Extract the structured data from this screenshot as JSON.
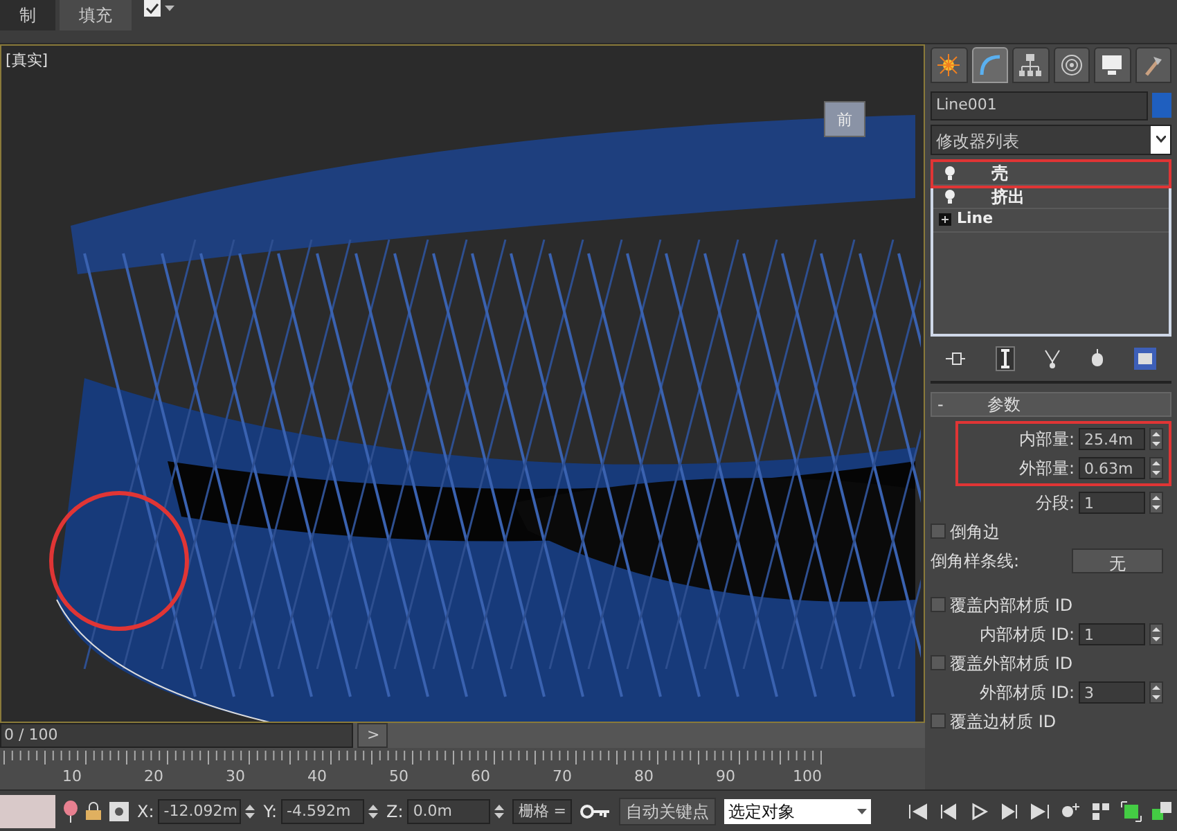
{
  "ribbon_tabs": [
    {
      "label": "制",
      "selected": true
    },
    {
      "label": "填充",
      "selected": false
    }
  ],
  "viewport": {
    "label": "[真实]",
    "viewcube_label": "前",
    "circle_marked": true
  },
  "command_tabs": [
    {
      "kind": "create",
      "selected": false
    },
    {
      "kind": "modify",
      "selected": true
    },
    {
      "kind": "hierarchy",
      "selected": false
    },
    {
      "kind": "motion",
      "selected": false
    },
    {
      "kind": "display",
      "selected": false
    },
    {
      "kind": "utilities",
      "selected": false
    }
  ],
  "object": {
    "name": "Line001",
    "color": "#1f5fbf"
  },
  "modifier_list": "修改器列表",
  "stack": [
    {
      "label": "壳",
      "kind": "modifier",
      "outlined": true
    },
    {
      "label": "挤出",
      "kind": "modifier",
      "outlined": false
    },
    {
      "label": "Line",
      "kind": "base",
      "outlined": false
    }
  ],
  "rollout": {
    "toggle": "-",
    "title": "参数",
    "outlined_spinners": [
      {
        "label": "内部量:",
        "value": "25.4m"
      },
      {
        "label": "外部量:",
        "value": "0.63m"
      }
    ],
    "spinners": [
      {
        "label": "分段:",
        "value": "1"
      }
    ],
    "bevel_edges": {
      "label": "倒角边",
      "checked": false
    },
    "bevel_spline": {
      "label": "倒角样条线:",
      "value": "无"
    },
    "overrides": [
      {
        "label": "覆盖内部材质 ID",
        "checked": false,
        "id_label": "内部材质 ID:",
        "id_value": "1"
      },
      {
        "label": "覆盖外部材质 ID",
        "checked": false,
        "id_label": "外部材质 ID:",
        "id_value": "3"
      },
      {
        "label": "覆盖边材质 ID",
        "checked": false
      }
    ]
  },
  "timeline": {
    "position": "0 / 100",
    "level": 0,
    "next": ">",
    "ticks": [
      "10",
      "20",
      "30",
      "40",
      "50",
      "60",
      "70",
      "80",
      "90",
      "100"
    ]
  },
  "status_bar": {
    "x_label": "X:",
    "x": "-12.092m",
    "y_label": "Y:",
    "y": "-4.592m",
    "z_label": "Z:",
    "z": "0.0m",
    "grid": "栅格 =",
    "auto_key": "自动关键点",
    "selection": "选定对象"
  }
}
